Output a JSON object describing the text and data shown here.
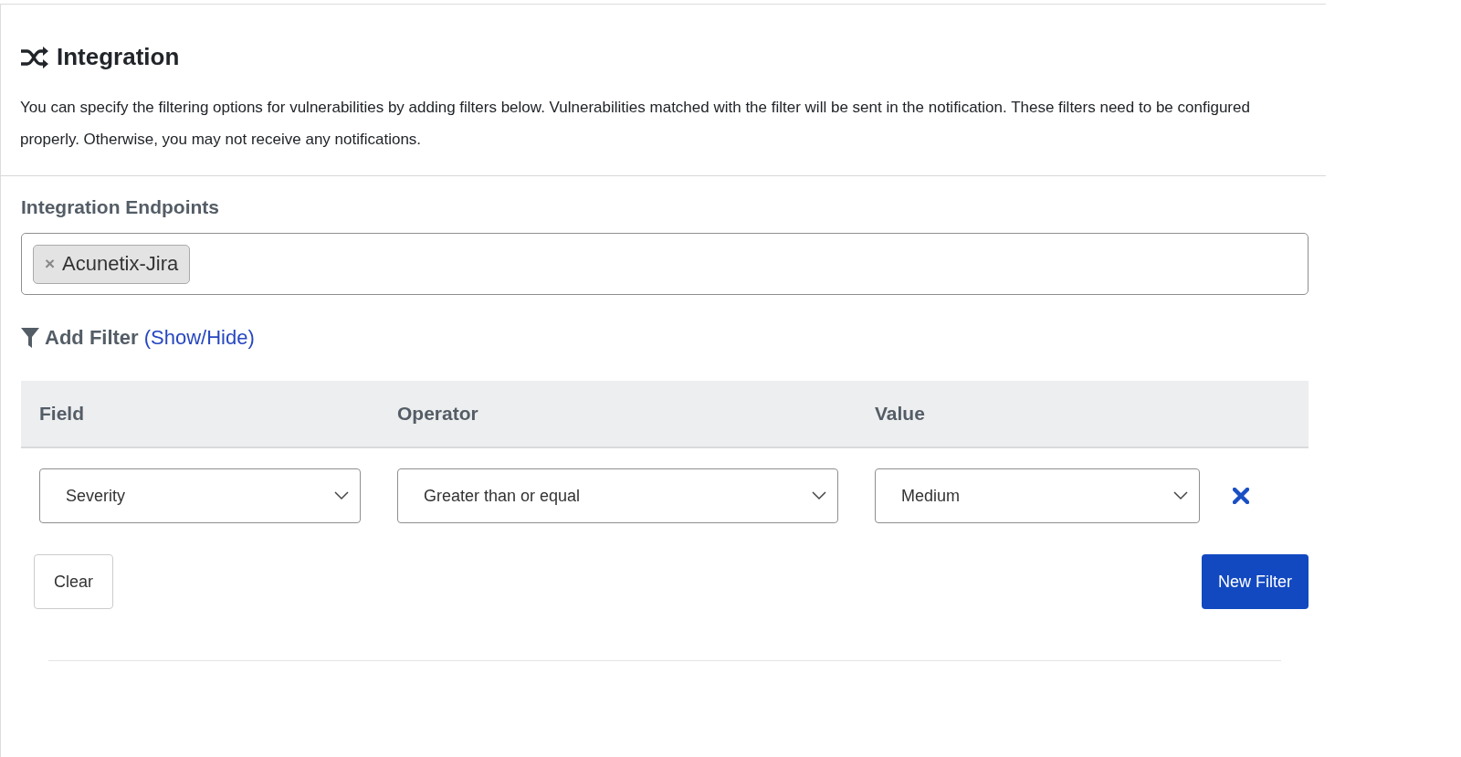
{
  "section": {
    "title": "Integration",
    "description": "You can specify the filtering options for vulnerabilities by adding filters below. Vulnerabilities matched with the filter will be sent in the notification. These filters need to be configured properly. Otherwise, you may not receive any notifications."
  },
  "endpoints": {
    "label": "Integration Endpoints",
    "tags": [
      {
        "remove": "×",
        "label": "Acunetix-Jira"
      }
    ]
  },
  "add_filter": {
    "label": "Add Filter",
    "toggle_link": "(Show/Hide)"
  },
  "filters_table": {
    "columns": [
      "Field",
      "Operator",
      "Value"
    ],
    "rows": [
      {
        "field": "Severity",
        "operator": "Greater than or equal",
        "value": "Medium"
      }
    ]
  },
  "buttons": {
    "clear": "Clear",
    "new_filter": "New Filter"
  }
}
